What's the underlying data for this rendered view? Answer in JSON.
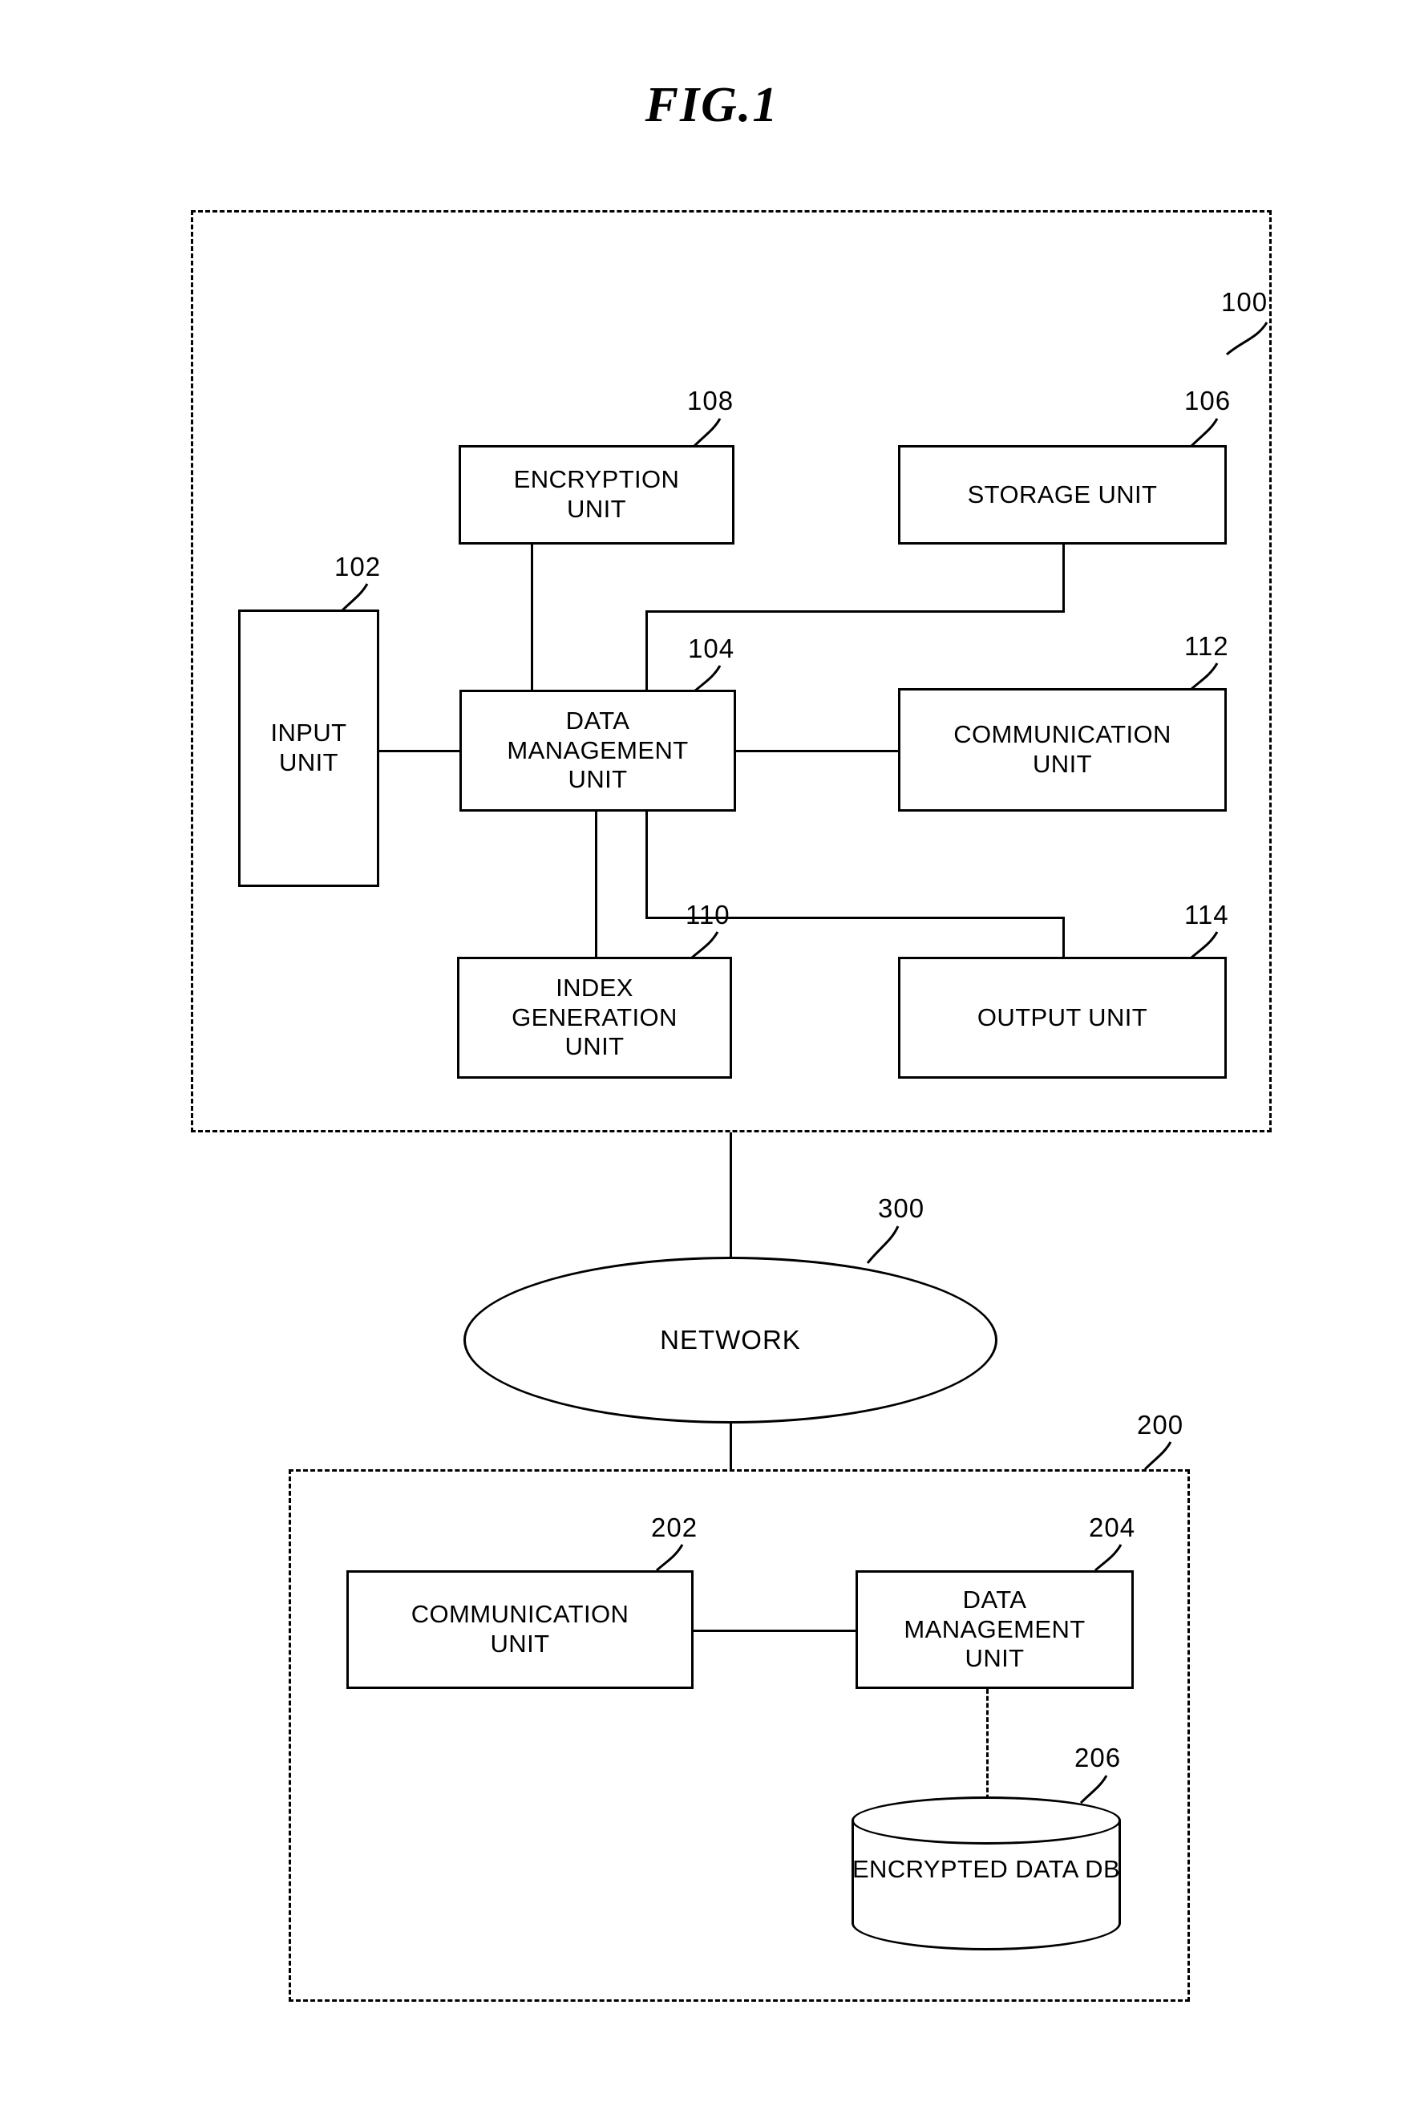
{
  "figure": {
    "title": "FIG.1"
  },
  "client_system": {
    "ref": "100",
    "blocks": {
      "input_unit": {
        "ref": "102",
        "line1": "INPUT",
        "line2": "UNIT"
      },
      "data_management_unit": {
        "ref": "104",
        "line1": "DATA",
        "line2": "MANAGEMENT",
        "line3": "UNIT"
      },
      "storage_unit": {
        "ref": "106",
        "line1": "STORAGE UNIT"
      },
      "encryption_unit": {
        "ref": "108",
        "line1": "ENCRYPTION",
        "line2": "UNIT"
      },
      "index_generation_unit": {
        "ref": "110",
        "line1": "INDEX",
        "line2": "GENERATION",
        "line3": "UNIT"
      },
      "communication_unit": {
        "ref": "112",
        "line1": "COMMUNICATION",
        "line2": "UNIT"
      },
      "output_unit": {
        "ref": "114",
        "line1": "OUTPUT UNIT"
      }
    }
  },
  "network": {
    "ref": "300",
    "label": "NETWORK"
  },
  "server_system": {
    "ref": "200",
    "blocks": {
      "communication_unit": {
        "ref": "202",
        "line1": "COMMUNICATION",
        "line2": "UNIT"
      },
      "data_management_unit": {
        "ref": "204",
        "line1": "DATA",
        "line2": "MANAGEMENT",
        "line3": "UNIT"
      },
      "encrypted_data_db": {
        "ref": "206",
        "line1": "ENCRYPTED",
        "line2": "DATA DB"
      }
    }
  }
}
